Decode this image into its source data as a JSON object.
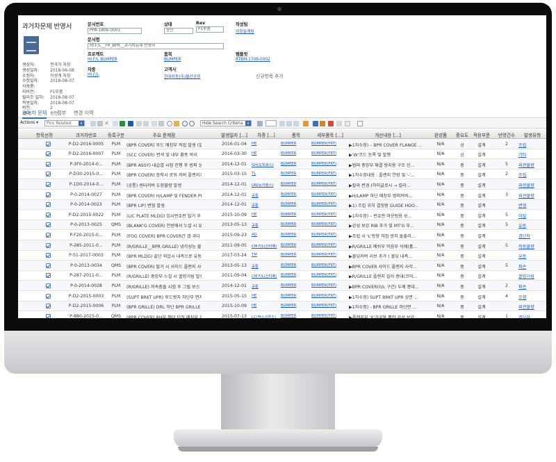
{
  "doc": {
    "title": "과거차문제 반영서",
    "meta": [
      {
        "k": "생성자:",
        "v": "권과거 차장"
      },
      {
        "k": "생성일자:",
        "v": "2018-06-08"
      },
      {
        "k": "수정자:",
        "v": "허생계 차장"
      },
      {
        "k": "수정일자:",
        "v": "2018-08-07"
      },
      {
        "k": "사용중:",
        "v": ""
      },
      {
        "k": "리비전:",
        "v": "P1부품"
      },
      {
        "k": "릴리즈 일자:",
        "v": "2018-08-07"
      },
      {
        "k": "적용일자:",
        "v": "2018-08-07"
      },
      {
        "k": "버전:",
        "v": "2"
      },
      {
        "k": "상태:",
        "v": "승인"
      }
    ]
  },
  "form": {
    "docno_label": "문서번호",
    "docno_value": "PPA-1806-0001",
    "status_label": "상태",
    "status_value": "승인",
    "rev_label": "Rev",
    "rev_value": "P1부품",
    "author_label": "작성팀",
    "author_value": "외장설계팀",
    "docname_label": "문서명",
    "docname_value": "HI.F/L__FR_BPR__과거차문제 반영서",
    "project_label": "프로젝트",
    "project_value": "HI.F/L BUMPER",
    "item_label": "품목",
    "item_value": "BUMPER",
    "template_label": "템플릿",
    "template_value": "RTBM-1708-0002",
    "car_label": "차종",
    "car_value": "HI.F/L",
    "customer_label": "고객사",
    "customer_value": "현대차동(주)울산공장",
    "add_link": "신규항목 추가"
  },
  "tabs": [
    "과거차 문제",
    "첨부",
    "변경 이력"
  ],
  "toolbar": {
    "actions": "Actions",
    "filter": "Pick Related",
    "hide": "Hide Search Criteria"
  },
  "columns": [
    "항목선정",
    "과거차번호",
    "등록구분",
    "주요 문제점",
    "발생일자 [...]",
    "차종 [...]",
    "품목",
    "세부품목 [...]",
    "개선내용 [...]",
    "완성품",
    "중요도",
    "적용부문",
    "반영건수",
    "발생유형"
  ],
  "rows": [
    {
      "no": "P-D2-2016-0005",
      "type": "PLM",
      "issue": "(BPR COVER) 후드 매칭부 직립 발생 (발생...",
      "date": "2016-01-04",
      "car": "HE",
      "item": "BUMPER",
      "sub": "BUMPER(FRT)",
      "imp": "▶1차수정) – BPR COVER FLANGE ...",
      "fin": "N/A",
      "pri": "상",
      "dept": "설계",
      "cnt": "2",
      "occ": "조립"
    },
    {
      "no": "P-D2-2016-0007",
      "type": "PLM",
      "issue": "(SCC COVER) 변색 및 내부 황종 박리",
      "date": "2016-03-30",
      "car": "HE",
      "item": "BUMPER",
      "sub": "BUMPER(FRT)",
      "imp": "▶'W'코드 등록 및 발행",
      "fin": "N/A",
      "pri": "상",
      "dept": "설계",
      "cnt": "",
      "occ": "기타"
    },
    {
      "no": "P-3F0-2014-0...",
      "type": "PLM",
      "issue": "(BPR ASSY) 내습열 시험 진행 후 범퍼 상단...",
      "date": "2014-12-01",
      "car": "GH(오피큐스)",
      "item": "BUMPER",
      "sub": "BUMPER(FRT)",
      "imp": "▶범퍼 중앙부 체결 방지용 구조 신...",
      "fin": "N/A",
      "pri": "중",
      "dept": "설계",
      "cnt": "5",
      "occ": "외관불량"
    },
    {
      "no": "P-D30-2015-0...",
      "type": "PLM",
      "issue": "(BPR COVER) 장착시 로워 커버 플랜지가 FE...",
      "date": "2015-03-15",
      "car": "TL",
      "item": "BUMPER",
      "sub": "BUMPER(FRT)",
      "imp": "▶1차수정내용 : 플랜지 연장 및 '-'...",
      "fin": "N/A",
      "pri": "중",
      "dept": "설계",
      "cnt": "2",
      "occ": "조립"
    },
    {
      "no": "P-1D0-2014-0...",
      "type": "PLM",
      "issue": "(공통) 센터커버 도장불량 발생",
      "date": "2014-12-01",
      "car": "UN(뉴카렌스)",
      "item": "BUMPER",
      "sub": "BUMPER(FRT)",
      "imp": "▶칼라 변경 (하이글로시 → 칼라...",
      "fin": "N/A",
      "pri": "중",
      "dept": "설계",
      "cnt": "",
      "occ": "외관불량"
    },
    {
      "no": "P-0-2014-0027",
      "type": "PLM",
      "issue": "(BPR COVER) H/LAMP 및 FENDER PNL 하단 ...",
      "date": "2014-12-01",
      "car": "공통",
      "item": "BUMPER",
      "sub": "BUMPER(FRT)",
      "imp": "▶H/LAMP 하단 매칭부 범퍼커버...",
      "fin": "N/A",
      "pri": "중",
      "dept": "설계",
      "cnt": "3",
      "occ": "외관불량"
    },
    {
      "no": "P-0-2014-0023",
      "type": "PLM",
      "issue": "(BPR LIP) 변형 발생",
      "date": "2014-12-01",
      "car": "공통",
      "item": "BUMPER",
      "sub": "BUMPER(FRT)",
      "imp": "▶1) 조립 위치 결정용 GUIDE HOO...",
      "fin": "N/A",
      "pri": "중",
      "dept": "설계",
      "cnt": "",
      "occ": "변형"
    },
    {
      "no": "P-D2-2015-0022",
      "type": "PLM",
      "issue": "(LIC PLATE MLDG) 입시번호판 탈거 후 등록...",
      "date": "2015-10-09",
      "car": "HE",
      "item": "BUMPER",
      "sub": "BUMPER(FRT)",
      "imp": "▶1차수정) – 번호판 마운팅용 보...",
      "fin": "N/A",
      "pri": "중",
      "dept": "설계",
      "cnt": "5",
      "occ": "이탈"
    },
    {
      "no": "P-0-2013-0025",
      "type": "QMS",
      "issue": "(BLANK'G COVER) 전방에서 누설 시 유동발생",
      "date": "2013-05-13",
      "car": "공통",
      "item": "BUMPER",
      "sub": "BUMPER(FRT)",
      "imp": "▶강성 보강 RIB 추가 및 MT'G 부...",
      "fin": "N/A",
      "pri": "중",
      "dept": "설계",
      "cnt": "5",
      "occ": "유동"
    },
    {
      "no": "P-F20-2015-0...",
      "type": "PLM",
      "issue": "(FOG COVER) BPR COVER간 갭 과다",
      "date": "2015-09-23",
      "car": "AD",
      "item": "BUMPER",
      "sub": "BUMPER(FRT)",
      "imp": "▶조립 시 'L'방향 처짐 방지 돌출리...",
      "fin": "N/A",
      "pri": "중",
      "dept": "설계",
      "cnt": "",
      "occ": "갭단차"
    },
    {
      "no": "P-285-2011-0...",
      "type": "PLM",
      "issue": "(R/GRILLE__BPR GRILLE) 냉각성능 불만족",
      "date": "2011-09-05",
      "car": "CM F/L(산타페)",
      "item": "BUMPER",
      "sub": "BUMPER(FRT)",
      "imp": "▶R/GRILLE 메쉬부 막음부 삭제(홀...",
      "fin": "N/A",
      "pri": "중",
      "dept": "설계",
      "cnt": "5",
      "occ": "작동불량"
    },
    {
      "no": "P-S1-2017-0003",
      "type": "PLM",
      "issue": "(BPR MLDG) 끝단 외압시 내측으로 유동발생",
      "date": "2017-03-24",
      "car": "TM",
      "item": "BUMPER",
      "sub": "BUMPER(FRT)",
      "imp": "▶몰딩커버 리브 추가 ( 몰딩 내측...",
      "fin": "N/A",
      "pri": "중",
      "dept": "설계",
      "cnt": "",
      "occ": "유동"
    },
    {
      "no": "P-0-2013-0034",
      "type": "QMS",
      "issue": "(BPR COVER) 탈거 시 사이드 플랜지 사각홀...",
      "date": "2013-05-13",
      "car": "공통",
      "item": "BUMPER",
      "sub": "BUMPER(FRT)",
      "imp": "▶BPR COVER 사이드 플랜지 사각...",
      "fin": "N/A",
      "pri": "중",
      "dept": "설계",
      "cnt": "5",
      "occ": "파손"
    },
    {
      "no": "P-287-2011-0...",
      "type": "PLM",
      "issue": "(R/GRILLE) 중앙부 누설 시 꿀렁거림 발생",
      "date": "2011-09-04",
      "car": "CM F/L(산타페)",
      "item": "BUMPER",
      "sub": "BUMPER(FRT)",
      "imp": "▶R/GRILLE 플랜지 길이 증대(코어...",
      "fin": "N/A",
      "pri": "중",
      "dept": "설계",
      "cnt": "",
      "occ": "꿀렁거림"
    },
    {
      "no": "P-0-2014-0028",
      "type": "PLM",
      "issue": "(R/GRILLE) 저속충돌 시험 후 그릴 보스 및 ...",
      "date": "2014-12-01",
      "car": "공통",
      "item": "BUMPER",
      "sub": "BUMPER(FRT)",
      "imp": "▶BPR COVER(0/L 구간) 두께 증대...",
      "fin": "N/A",
      "pri": "중",
      "dept": "설계",
      "cnt": "2",
      "occ": "파손"
    },
    {
      "no": "P-D2-2015-0003",
      "type": "PLM",
      "issue": "(SUPT BRKT UPR) 후드랫치 하단부 면저방...",
      "date": "2015-05-15",
      "car": "HE",
      "item": "BUMPER",
      "sub": "BUMPER(FRT)",
      "imp": "▶1차수정) SUPT BRKT UPR 상면 ...",
      "fin": "N/A",
      "pri": "중",
      "dept": "설계",
      "cnt": "4",
      "occ": "오염"
    },
    {
      "no": "P-D2-2015-0006",
      "type": "PLM",
      "issue": "(BPR GRILLE) DRL 하단 BPR GRILLE 처짐 발생",
      "date": "2015-10-09",
      "car": "HE",
      "item": "BUMPER",
      "sub": "BUMPER(FRT)",
      "imp": "▶1차수정) - BPR GRILLE 하단면 ...",
      "fin": "N/A",
      "pri": "중",
      "dept": "설계",
      "cnt": "",
      "occ": "외관불량"
    },
    {
      "no": "P-880-2015-0...",
      "type": "QMS",
      "issue": "(BPR COVER) RH부 헨더 단절 매칭부 갭 불...",
      "date": "2015-07-13",
      "car": "LC(맥스크루즈)",
      "item": "BUMPER",
      "sub": "BUMPER(FRT)",
      "imp": "▶플렌지부 'X'가공용 홀만 강성 보강...",
      "fin": "N/A",
      "pri": "중",
      "dept": "설계",
      "cnt": "1",
      "occ": "갭단차"
    }
  ],
  "colors": {
    "accent": "#2f6cb8",
    "link": "#1a56c4",
    "bezel": "#0c0c0c"
  }
}
